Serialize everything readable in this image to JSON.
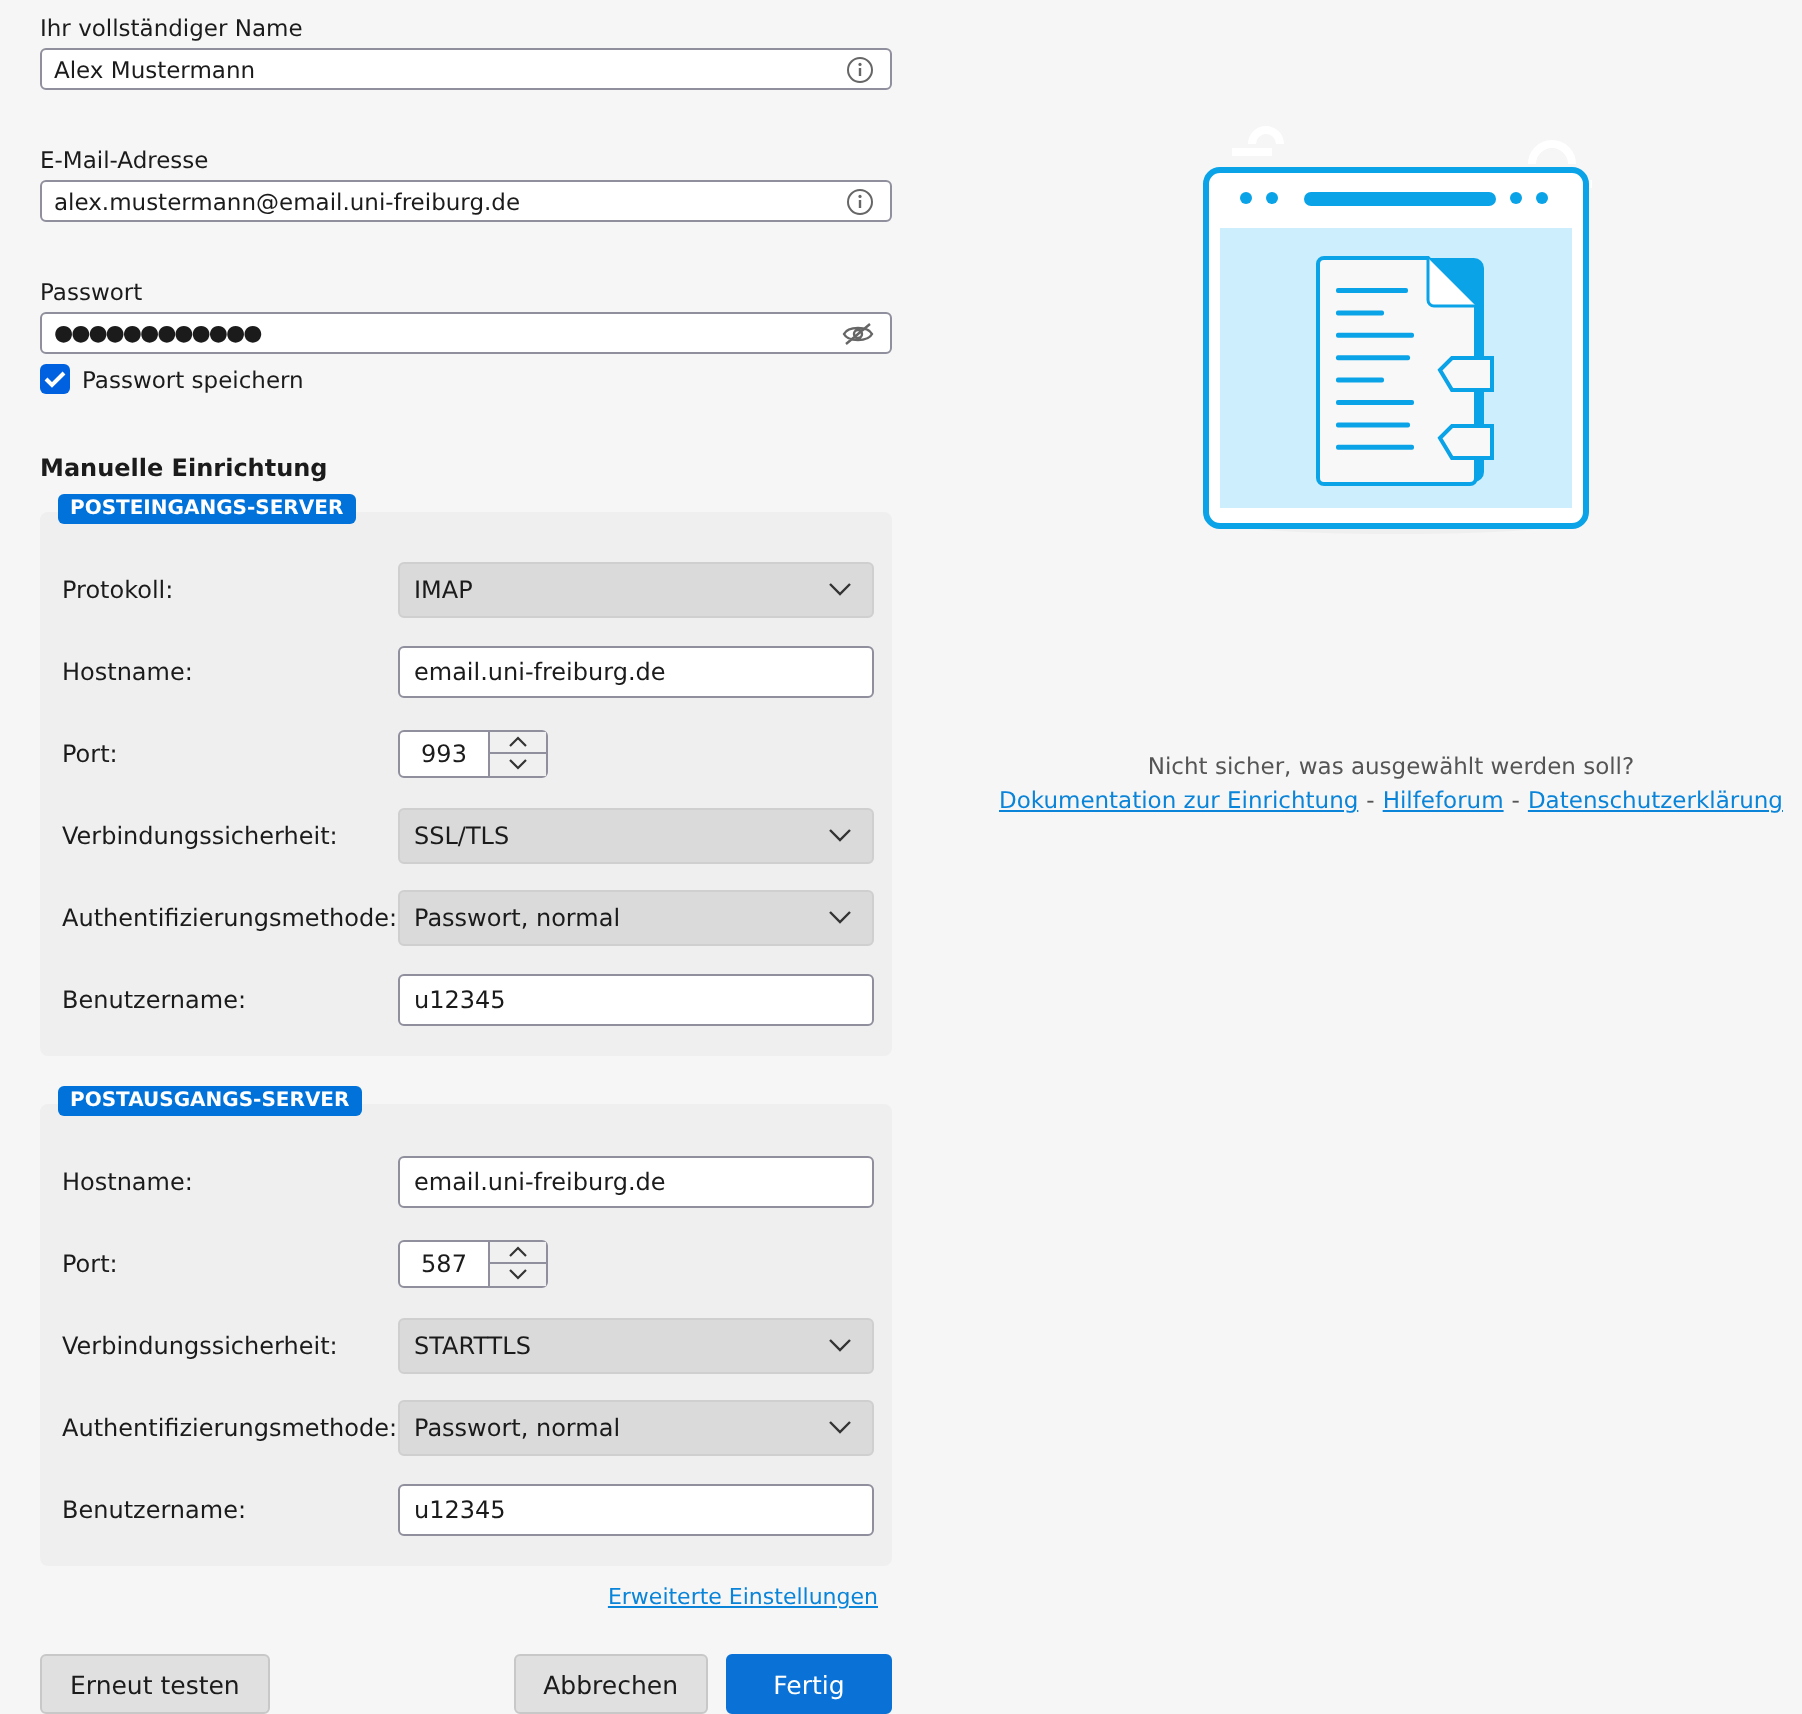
{
  "fields": [
    {
      "label": "Ihr vollständiger Name",
      "value": "Alex Mustermann",
      "kind": "info"
    },
    {
      "label": "E-Mail-Adresse",
      "value": "alex.mustermann@email.uni-freiburg.de",
      "kind": "info"
    },
    {
      "label": "Passwort",
      "value": "●●●●●●●●●●●●",
      "kind": "password"
    }
  ],
  "remember_password": {
    "label": "Passwort speichern",
    "checked": true
  },
  "manual_setup": {
    "title": "Manuelle Einrichtung",
    "sections": [
      {
        "badge": "POSTEINGANGS-SERVER",
        "rows": [
          {
            "label": "Protokoll:",
            "kind": "select",
            "value": "IMAP"
          },
          {
            "label": "Hostname:",
            "kind": "text",
            "value": "email.uni-freiburg.de"
          },
          {
            "label": "Port:",
            "kind": "spinner",
            "value": "993"
          },
          {
            "label": "Verbindungssicherheit:",
            "kind": "select",
            "value": "SSL/TLS"
          },
          {
            "label": "Authentifizierungsmethode:",
            "kind": "select",
            "value": "Passwort, normal"
          },
          {
            "label": "Benutzername:",
            "kind": "text",
            "value": "u12345"
          }
        ]
      },
      {
        "badge": "POSTAUSGANGS-SERVER",
        "rows": [
          {
            "label": "Hostname:",
            "kind": "text",
            "value": "email.uni-freiburg.de"
          },
          {
            "label": "Port:",
            "kind": "spinner",
            "value": "587"
          },
          {
            "label": "Verbindungssicherheit:",
            "kind": "select",
            "value": "STARTTLS"
          },
          {
            "label": "Authentifizierungsmethode:",
            "kind": "select",
            "value": "Passwort, normal"
          },
          {
            "label": "Benutzername:",
            "kind": "text",
            "value": "u12345"
          }
        ]
      }
    ],
    "advanced_link": "Erweiterte Einstellungen"
  },
  "buttons_left": [
    {
      "label": "Erneut testen",
      "kind": "secondary"
    }
  ],
  "buttons_right": [
    {
      "label": "Abbrechen",
      "kind": "secondary"
    },
    {
      "label": "Fertig",
      "kind": "primary"
    }
  ],
  "help": {
    "question": "Nicht sicher, was ausgewählt werden soll?",
    "items": [
      {
        "kind": "link",
        "text": "Dokumentation zur Einrichtung"
      },
      {
        "kind": "separator",
        "text": "-"
      },
      {
        "kind": "link",
        "text": "Hilfeforum"
      },
      {
        "kind": "separator",
        "text": "-"
      },
      {
        "kind": "link",
        "text": "Datenschutzerklärung"
      }
    ]
  }
}
